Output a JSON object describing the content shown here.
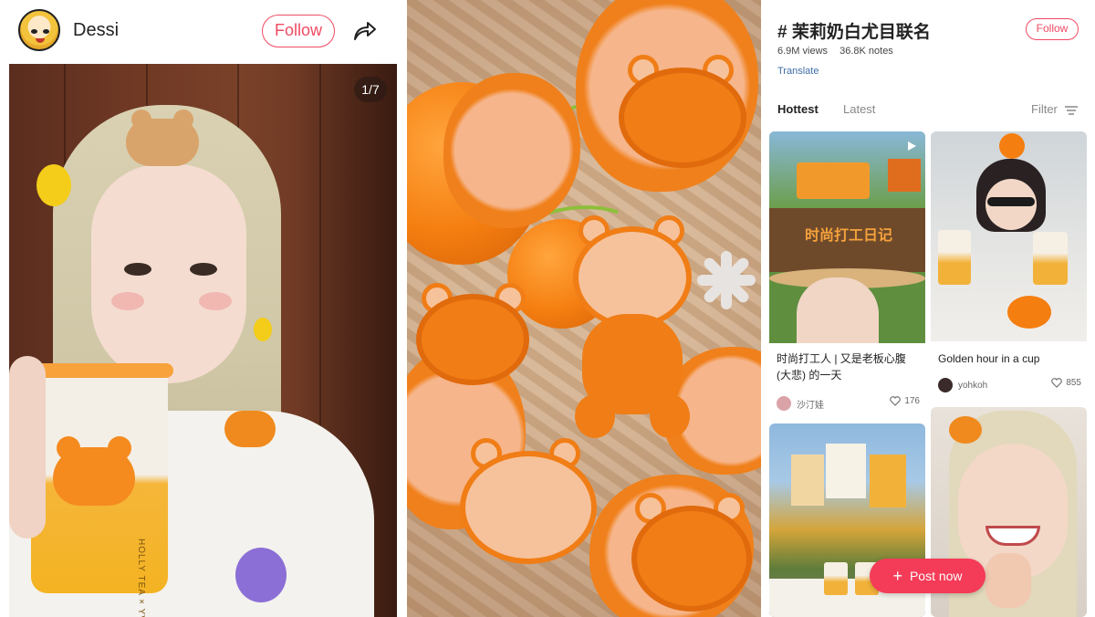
{
  "profile_post": {
    "username": "Dessi",
    "follow_label": "Follow",
    "image_counter": "1/7",
    "cup_brand_text": "HOLLY TEA × YVMIN"
  },
  "topic_page": {
    "title": "# 茉莉奶白尤目联名",
    "follow_label": "Follow",
    "views": "6.9M views",
    "notes": "36.8K notes",
    "translate": "Translate",
    "tabs": [
      "Hottest",
      "Latest"
    ],
    "filter_label": "Filter",
    "cards": [
      {
        "title": "时尚打工人 | 又是老板心腹 (大悲) 的一天",
        "user": "沙汀娃",
        "likes": "176",
        "image_text": "时尚打工日记"
      },
      {
        "title": "Golden hour in a cup",
        "user": "yohkoh",
        "likes": "855"
      },
      {
        "title": ""
      },
      {
        "title": ""
      }
    ],
    "post_button": "Post now"
  },
  "colors": {
    "accent": "#f04a63",
    "post_button": "#f43b57",
    "link": "#3f6ea8",
    "orange": "#f57e10"
  },
  "icons": [
    "share-icon",
    "filter-icon",
    "heart-icon",
    "plus-icon",
    "play-icon"
  ]
}
